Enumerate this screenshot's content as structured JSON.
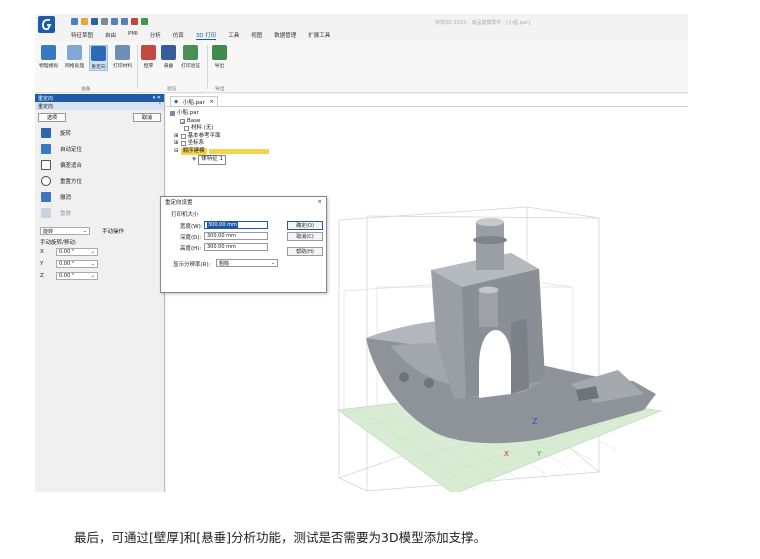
{
  "window_title": "快刻3D 2023 - 成品建模零件 - [小船.par]",
  "menu": [
    "特征草图",
    "自由",
    "PMI",
    "分析",
    "仿真",
    "3D 打印",
    "工具",
    "视图",
    "数据管理",
    "扩展工具"
  ],
  "menu_active": "3D 打印",
  "ribbon": {
    "buttons": [
      {
        "label": "物理模拟"
      },
      {
        "label": "网格处理"
      },
      {
        "label": "重定向"
      },
      {
        "label": "打印材料"
      },
      {
        "label": "壁厚"
      },
      {
        "label": "悬垂"
      },
      {
        "label": "打印验证"
      },
      {
        "label": "导出"
      }
    ],
    "groups": [
      {
        "label": "准备"
      },
      {
        "label": "验证"
      },
      {
        "label": "导出"
      }
    ]
  },
  "toolbar2": [
    "拉伸",
    "草图",
    "孔",
    "倒角",
    "当前模型的预览",
    "快速建模",
    "文件属性",
    "边界",
    "材料表",
    "当前模型的渲染"
  ],
  "panel": {
    "title": "重定向",
    "subtitle": "重定向",
    "ok": "选项",
    "cancel": "取消",
    "items": [
      {
        "label": "旋转"
      },
      {
        "label": "自动定位"
      },
      {
        "label": "偏差适合"
      },
      {
        "label": "重置方位"
      },
      {
        "label": "撤消"
      },
      {
        "label": "重做"
      }
    ],
    "mode_select": "旋转",
    "mode_label": "手动操作",
    "manual_label": "手动旋转/移动:",
    "axes": [
      {
        "axis": "X",
        "value": "0.00 °"
      },
      {
        "axis": "Y",
        "value": "0.00 °"
      },
      {
        "axis": "Z",
        "value": "0.00 °"
      }
    ]
  },
  "tab": {
    "label": "小船.par",
    "close": "×"
  },
  "tree": [
    "小船.par",
    "Base",
    "材料 (无)",
    "基本参考平面",
    "坐标系",
    "顺序建模",
    "体特征 1"
  ],
  "dialog": {
    "title": "重定向设置",
    "close": "×",
    "section": "打印机大小",
    "fields": [
      {
        "label": "宽度(W):",
        "value": "300.00 mm"
      },
      {
        "label": "深度(D):",
        "value": "300.00 mm"
      },
      {
        "label": "高度(H):",
        "value": "300.00 mm"
      }
    ],
    "res_label": "显示分辨率(R):",
    "res_value": "粗糙",
    "ok": "确定(O)",
    "cancel": "取消(C)",
    "help": "帮助(H)"
  },
  "axis_labels": {
    "z": "Z",
    "x": "X",
    "y": "Y"
  },
  "caption": "最后，可通过[壁厚]和[悬垂]分析功能，测试是否需要为3D模型添加支撑。",
  "colors": {
    "accent": "#1e5aa8",
    "model": "#8e939a",
    "plate": "#cfe8cc",
    "highlight": "#f7d24d"
  }
}
